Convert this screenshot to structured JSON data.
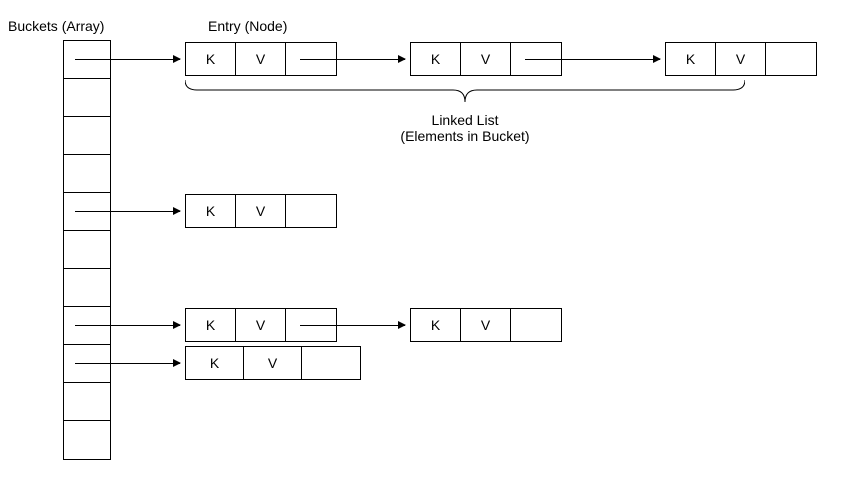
{
  "labels": {
    "buckets": "Buckets (Array)",
    "entry": "Entry (Node)",
    "linkedList": "Linked List",
    "elements": "(Elements in Bucket)"
  },
  "cellLabels": {
    "key": "K",
    "value": "V"
  },
  "bucketCount": 11,
  "rows": [
    {
      "bucketIndex": 0,
      "entries": 3
    },
    {
      "bucketIndex": 4,
      "entries": 1
    },
    {
      "bucketIndex": 7,
      "entries": 2
    },
    {
      "bucketIndex": 8,
      "entries": 1
    }
  ]
}
